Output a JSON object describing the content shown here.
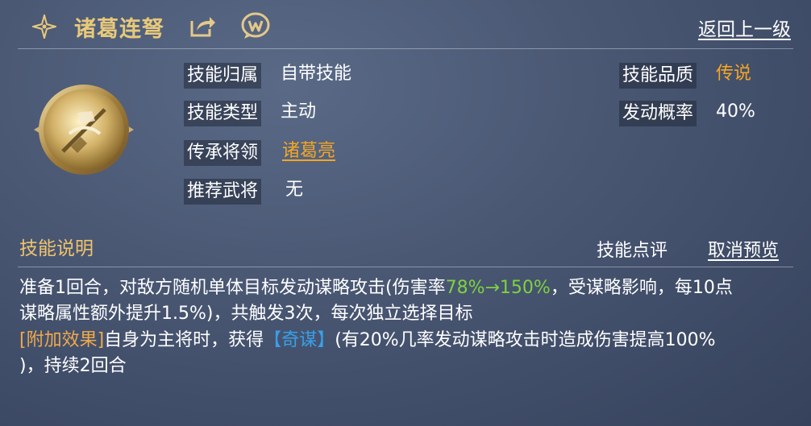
{
  "header": {
    "title": "诸葛连弩",
    "back_label": "返回上一级",
    "icons": [
      "sparkle-star-icon",
      "share-icon",
      "w-logo-icon"
    ]
  },
  "skill_info": {
    "left": [
      {
        "label": "技能归属",
        "value": "自带技能"
      },
      {
        "label": "技能类型",
        "value": "主动"
      },
      {
        "label": "传承将领",
        "value": "诸葛亮"
      },
      {
        "label": "推荐武将",
        "value": "无"
      }
    ],
    "right": [
      {
        "label": "技能品质",
        "value": "传说"
      },
      {
        "label": "发动概率",
        "value": "40%"
      }
    ]
  },
  "section": {
    "title": "技能说明",
    "review_label": "技能点评",
    "cancel_preview_label": "取消预览"
  },
  "description": {
    "l1_a": "准备1回合，对敌方随机单体目标发动谋略攻击(伤害率",
    "l1_b": "78%→150%",
    "l1_c": "，受谋略影响，每10点",
    "l2": "谋略属性额外提升1.5%)，共触发3次，每次独立选择目标",
    "l3_tag": "[附加效果]",
    "l3_a": "自身为主将时，获得",
    "l3_b": "【奇谋】",
    "l3_c": "(有20%几率发动谋略攻击时造成伤害提高100%",
    "l4": ")，持续2回合"
  },
  "colors": {
    "gold_title": "#e8c97a",
    "quality_orange": "#f5a623",
    "rate_green": "#7ed23f",
    "keyword_blue": "#38a0e8",
    "tag_orange": "#f0a94b"
  }
}
